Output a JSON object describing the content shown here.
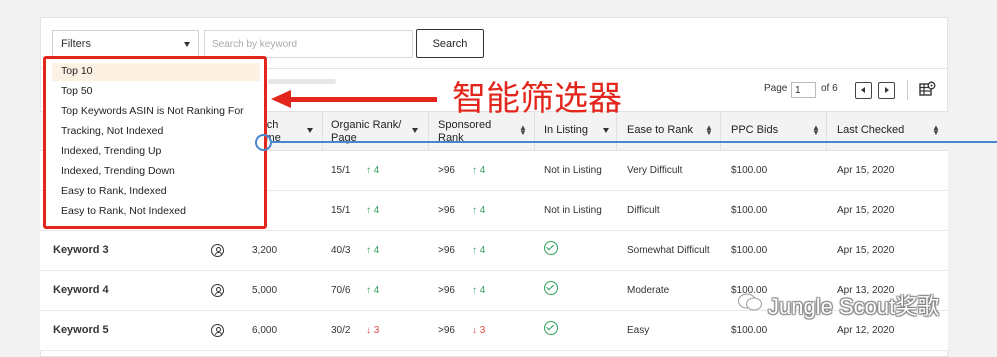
{
  "toolbar": {
    "filters_label": "Filters",
    "search_placeholder": "Search by keyword",
    "search_button": "Search"
  },
  "pager": {
    "page_label": "Page",
    "page_value": "1",
    "of_label": "of 6"
  },
  "columns": {
    "search_volume": [
      "arch",
      "lume"
    ],
    "organic_rank": [
      "Organic Rank/",
      "Page"
    ],
    "sponsored_rank": [
      "Sponsored",
      "Rank"
    ],
    "in_listing": "In Listing",
    "ease_to_rank": "Ease to Rank",
    "ppc_bids": "PPC Bids",
    "last_checked": "Last Checked"
  },
  "rows": [
    {
      "keyword": "",
      "volume": "00",
      "organic": "15/1",
      "organic_delta": "↑ 4",
      "organic_dir": "up",
      "sponsored": ">96",
      "sponsored_delta": "↑ 4",
      "sponsored_dir": "up",
      "listing": "Not in Listing",
      "ease": "Very Difficult",
      "ppc": "$100.00",
      "date": "Apr 15, 2020"
    },
    {
      "keyword": "",
      "volume": "00",
      "organic": "15/1",
      "organic_delta": "↑ 4",
      "organic_dir": "up",
      "sponsored": ">96",
      "sponsored_delta": "↑ 4",
      "sponsored_dir": "up",
      "listing": "Not in Listing",
      "ease": "Difficult",
      "ppc": "$100.00",
      "date": "Apr 15, 2020"
    },
    {
      "keyword": "Keyword 3",
      "volume": "3,200",
      "organic": "40/3",
      "organic_delta": "↑ 4",
      "organic_dir": "up",
      "sponsored": ">96",
      "sponsored_delta": "↑ 4",
      "sponsored_dir": "up",
      "listing": "check",
      "ease": "Somewhat Difficult",
      "ppc": "$100.00",
      "date": "Apr 15, 2020"
    },
    {
      "keyword": "Keyword 4",
      "volume": "5,000",
      "organic": "70/6",
      "organic_delta": "↑ 4",
      "organic_dir": "up",
      "sponsored": ">96",
      "sponsored_delta": "↑ 4",
      "sponsored_dir": "up",
      "listing": "check",
      "ease": "Moderate",
      "ppc": "$100.00",
      "date": "Apr 13, 2020"
    },
    {
      "keyword": "Keyword 5",
      "volume": "6,000",
      "organic": "30/2",
      "organic_delta": "↓ 3",
      "organic_dir": "down",
      "sponsored": ">96",
      "sponsored_delta": "↓ 3",
      "sponsored_dir": "down",
      "listing": "check",
      "ease": "Easy",
      "ppc": "$100.00",
      "date": "Apr 12, 2020"
    }
  ],
  "dropdown": {
    "items": [
      "Top 10",
      "Top 50",
      "Top Keywords ASIN is Not Ranking For",
      "Tracking, Not Indexed",
      "Indexed, Trending Up",
      "Indexed, Trending Down",
      "Easy to Rank, Indexed",
      "Easy to Rank, Not Indexed"
    ]
  },
  "annotation": "智能筛选器",
  "watermark": "Jungle Scout奖歌",
  "colors": {
    "accent_red": "#e2261c",
    "up_green": "#2fa05a",
    "down_red": "#d84848",
    "guide_blue": "#4a86cf"
  }
}
